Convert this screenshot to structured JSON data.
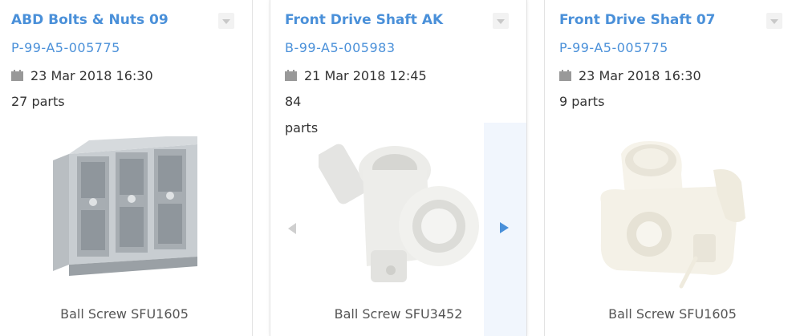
{
  "cards": [
    {
      "title": "ABD Bolts & Nuts 09",
      "part_number": "P-99-A5-005775",
      "date": "23 Mar 2018 16:30",
      "parts": "27 parts",
      "caption": "Ball Screw SFU1605"
    },
    {
      "title": "Front Drive Shaft AK",
      "part_number": "B-99-A5-005983",
      "date": "21 Mar 2018 12:45",
      "parts_count": "84",
      "parts_unit": "parts",
      "caption": "Ball Screw SFU3452"
    },
    {
      "title": "Front Drive Shaft 07",
      "part_number": "P-99-A5-005775",
      "date": "23 Mar 2018 16:30",
      "parts": "9 parts",
      "caption": "Ball Screw SFU1605"
    }
  ],
  "colors": {
    "link": "#4a90d9",
    "nav_panel": "#f1f6fd"
  },
  "icons": {
    "menu": "dropdown-triangle-icon",
    "date": "calendar-icon",
    "prev": "chevron-left-icon",
    "next": "chevron-right-icon"
  }
}
